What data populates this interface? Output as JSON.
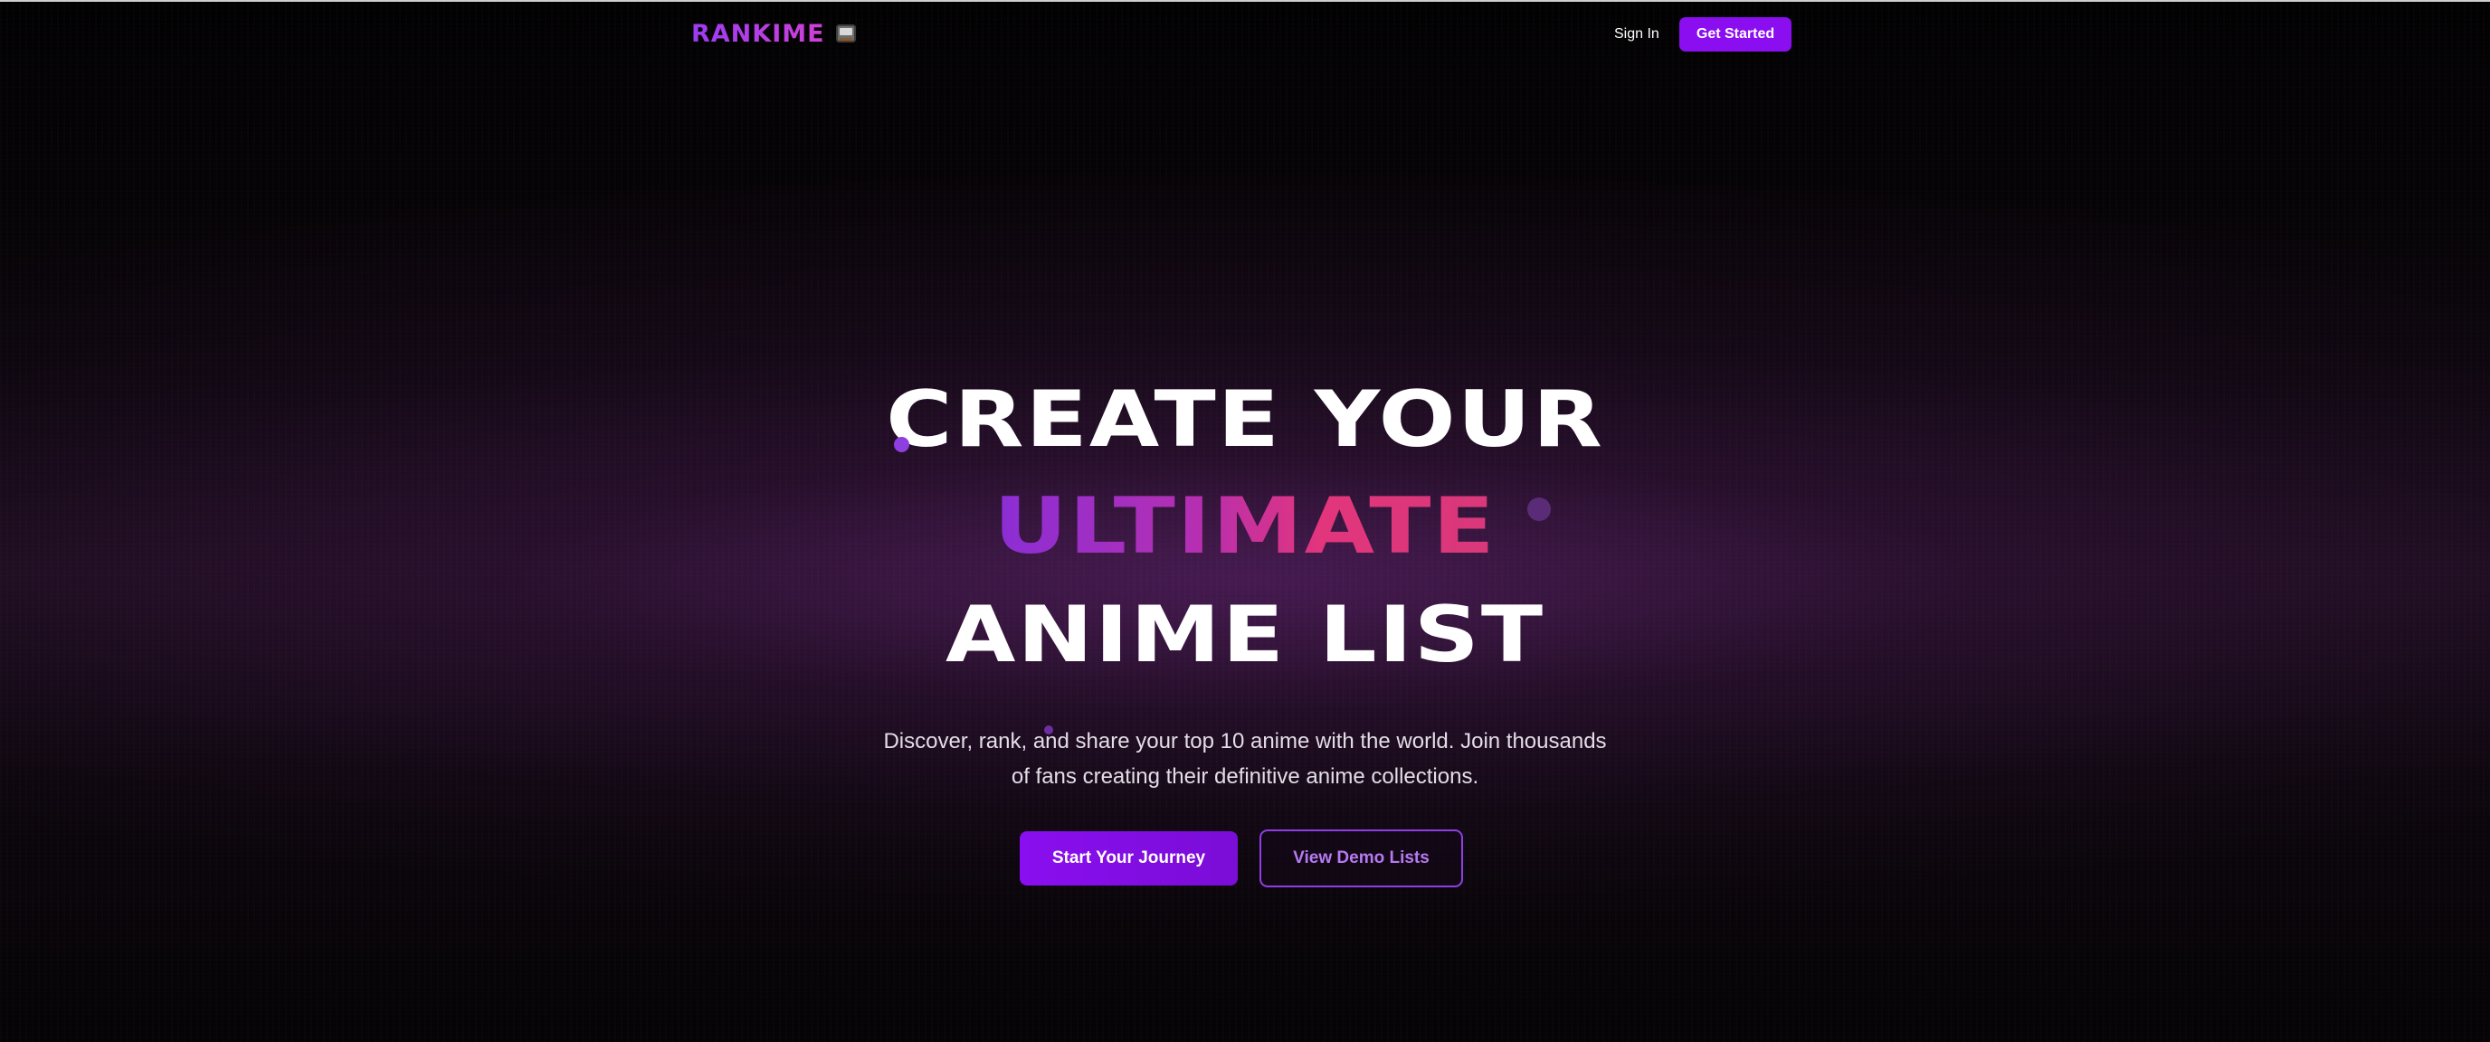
{
  "nav": {
    "logo_text": "RANKIME",
    "logo_icon": "tv-icon",
    "signin_label": "Sign In",
    "get_started_label": "Get Started"
  },
  "hero": {
    "headline_line1": "CREATE YOUR",
    "headline_line2": "ULTIMATE",
    "headline_line3": "ANIME LIST",
    "subtitle": "Discover, rank, and share your top 10 anime with the world. Join thousands of fans creating their definitive anime collections.",
    "primary_cta": "Start Your Journey",
    "secondary_cta": "View Demo Lists"
  },
  "colors": {
    "accent": "#8a0ef0",
    "gradient_start": "#8a2ed6",
    "gradient_end": "#e2357c",
    "background": "#050305"
  }
}
